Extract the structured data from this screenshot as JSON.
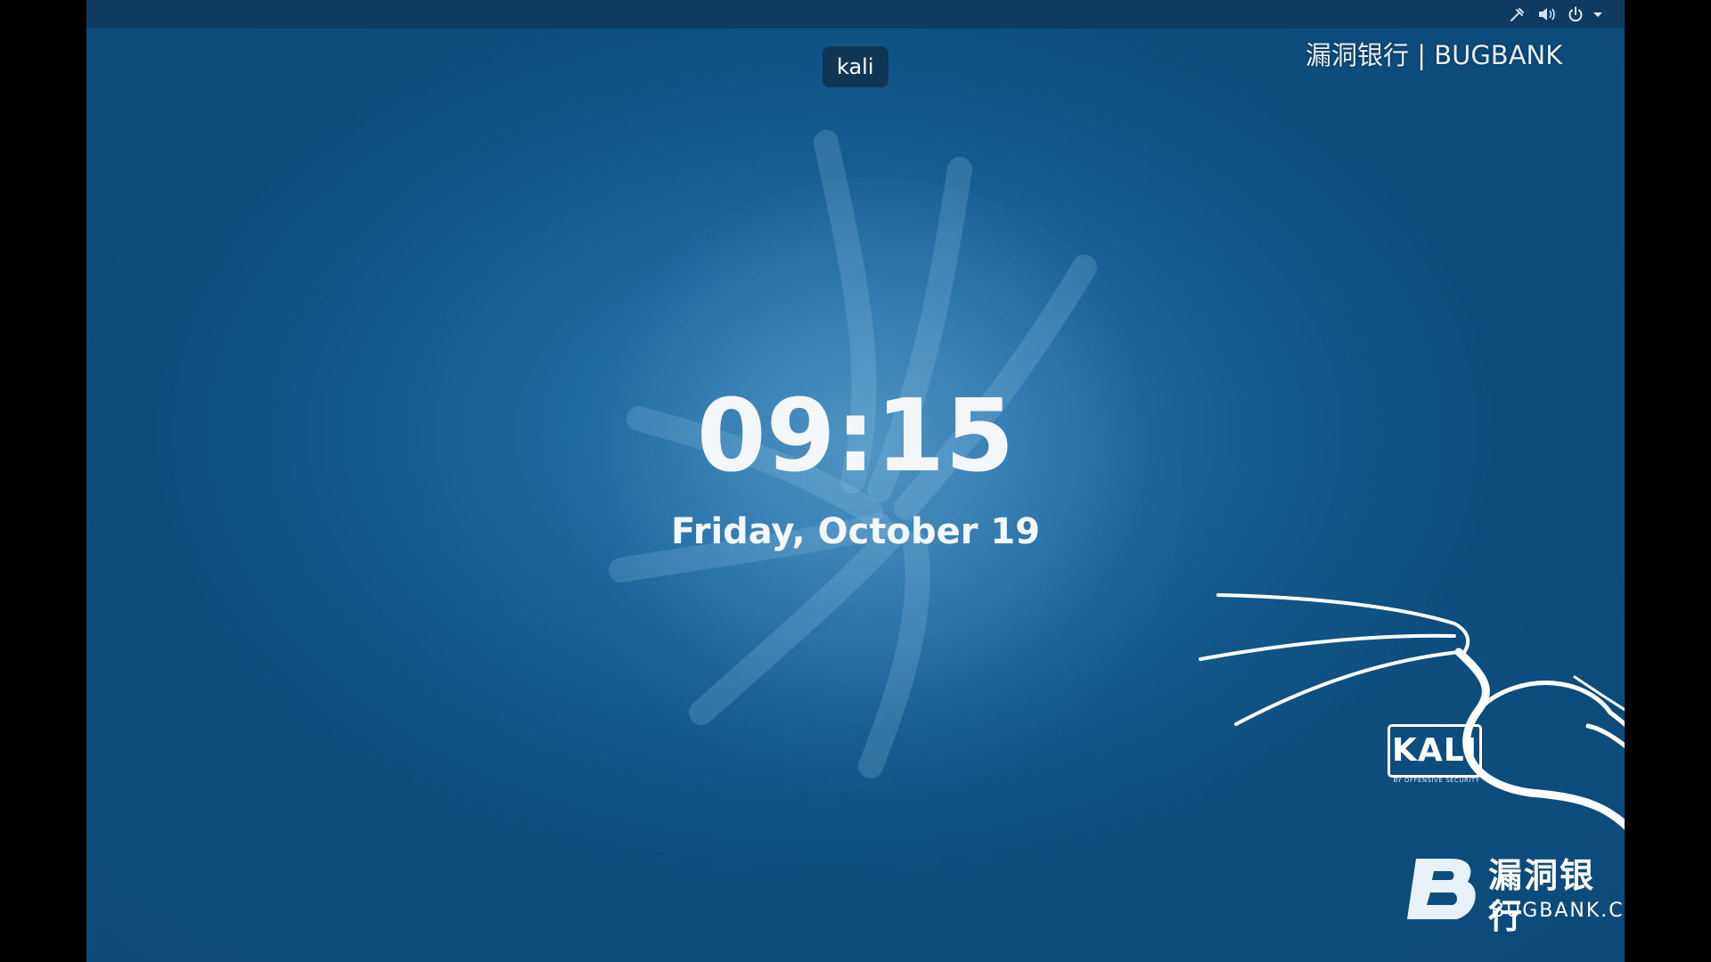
{
  "screen": {
    "user_label": "kali",
    "time": "09:15",
    "date": "Friday, October 19"
  },
  "tray": {
    "icons": [
      "network-wired-icon",
      "volume-icon",
      "power-icon",
      "chevron-down-icon"
    ]
  },
  "watermark_top": {
    "text": "漏洞银行 | BUGBANK"
  },
  "branding": {
    "kali_badge": "KALI",
    "kali_tagline": "BY OFFENSIVE SECURITY",
    "bugbank_cn": "漏洞银行",
    "bugbank_en": "BUGBANK.CN"
  },
  "colors": {
    "background": "#0b4a79",
    "topbar": "#0e3b5f",
    "text": "#f4f7fa"
  }
}
